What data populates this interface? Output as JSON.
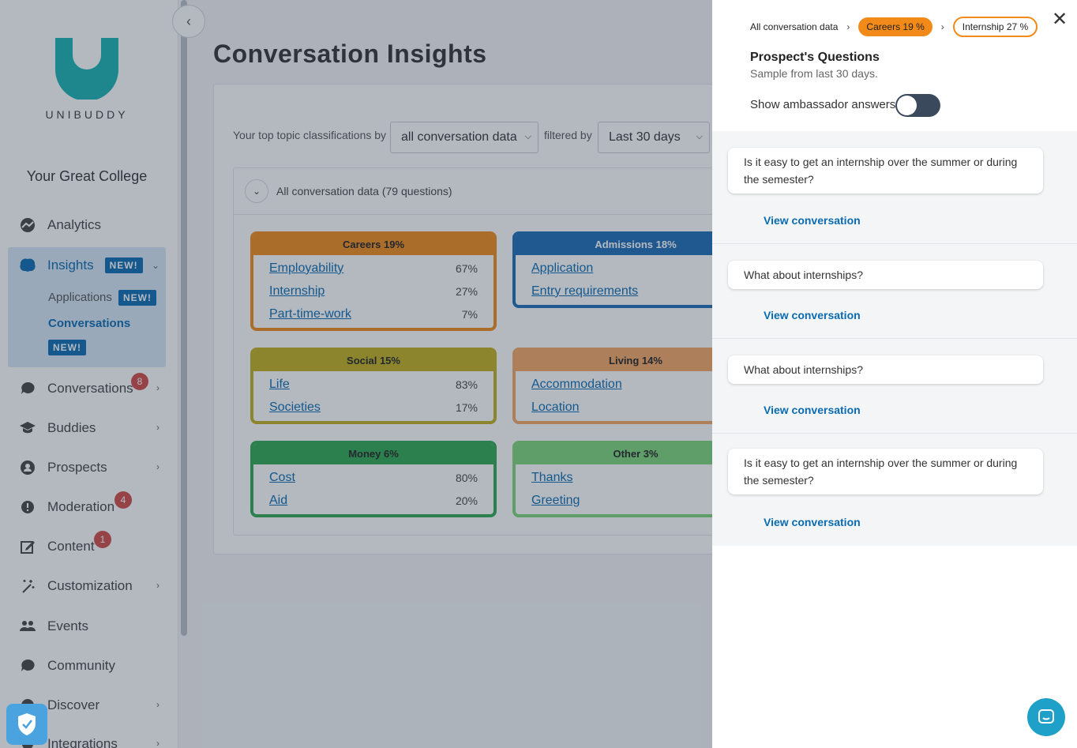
{
  "sidebar": {
    "logo_text": "UNIBUDDY",
    "college": "Your Great College",
    "items": {
      "analytics": "Analytics",
      "insights": "Insights",
      "insights_badge": "NEW!",
      "applications": "Applications",
      "applications_badge": "NEW!",
      "conversations_sub": "Conversations",
      "conversations_sub_badge": "NEW!",
      "conversations": "Conversations",
      "conversations_count": "8",
      "buddies": "Buddies",
      "prospects": "Prospects",
      "moderation": "Moderation",
      "moderation_count": "4",
      "content": "Content",
      "content_count": "1",
      "customization": "Customization",
      "events": "Events",
      "community": "Community",
      "discover": "Discover",
      "integrations": "Integrations"
    }
  },
  "main": {
    "title": "Conversation Insights",
    "filter_prefix": "Your top topic classifications by",
    "filter_by_value": "all conversation data",
    "filter_mid": "filtered by",
    "period_value": "Last 30 days",
    "all_data_label": "All conversation data (79 questions)",
    "topics": [
      {
        "title": "Careers 19%",
        "rows": [
          {
            "label": "Employability",
            "pct": "67%"
          },
          {
            "label": "Internship",
            "pct": "27%"
          },
          {
            "label": "Part-time-work",
            "pct": "7%"
          }
        ]
      },
      {
        "title": "Admissions 18%",
        "rows": [
          {
            "label": "Application",
            "pct": ""
          },
          {
            "label": "Entry requirements",
            "pct": ""
          }
        ]
      },
      {
        "title": "Social 15%",
        "rows": [
          {
            "label": "Life",
            "pct": "83%"
          },
          {
            "label": "Societies",
            "pct": "17%"
          }
        ]
      },
      {
        "title": "Living 14%",
        "rows": [
          {
            "label": "Accommodation",
            "pct": ""
          },
          {
            "label": "Location",
            "pct": ""
          }
        ]
      },
      {
        "title": "Money 6%",
        "rows": [
          {
            "label": "Cost",
            "pct": "80%"
          },
          {
            "label": "Aid",
            "pct": "20%"
          }
        ]
      },
      {
        "title": "Other 3%",
        "rows": [
          {
            "label": "Thanks",
            "pct": ""
          },
          {
            "label": "Greeting",
            "pct": ""
          }
        ]
      }
    ]
  },
  "panel": {
    "crumb_all": "All conversation data",
    "crumb_careers": "Careers 19 %",
    "crumb_internship": "Internship 27 %",
    "title": "Prospect's Questions",
    "subtitle": "Sample from last 30 days.",
    "toggle_label": "Show ambassador answers",
    "questions": [
      {
        "text": "Is it easy to get an internship over the summer or during the semester?",
        "link": "View conversation"
      },
      {
        "text": "What about internships?",
        "link": "View conversation"
      },
      {
        "text": "What about internships?",
        "link": "View conversation"
      },
      {
        "text": "Is it easy to get an internship over the summer or during the semester?",
        "link": "View conversation"
      }
    ]
  },
  "colors": {
    "careers": "#f28a1a",
    "admissions": "#1c6bb5",
    "social": "#c2b01e",
    "living": "#f5a765",
    "money": "#2fa84f",
    "other": "#7fd67a",
    "brand": "#0a6bb1",
    "logo": "#19b3b1"
  }
}
